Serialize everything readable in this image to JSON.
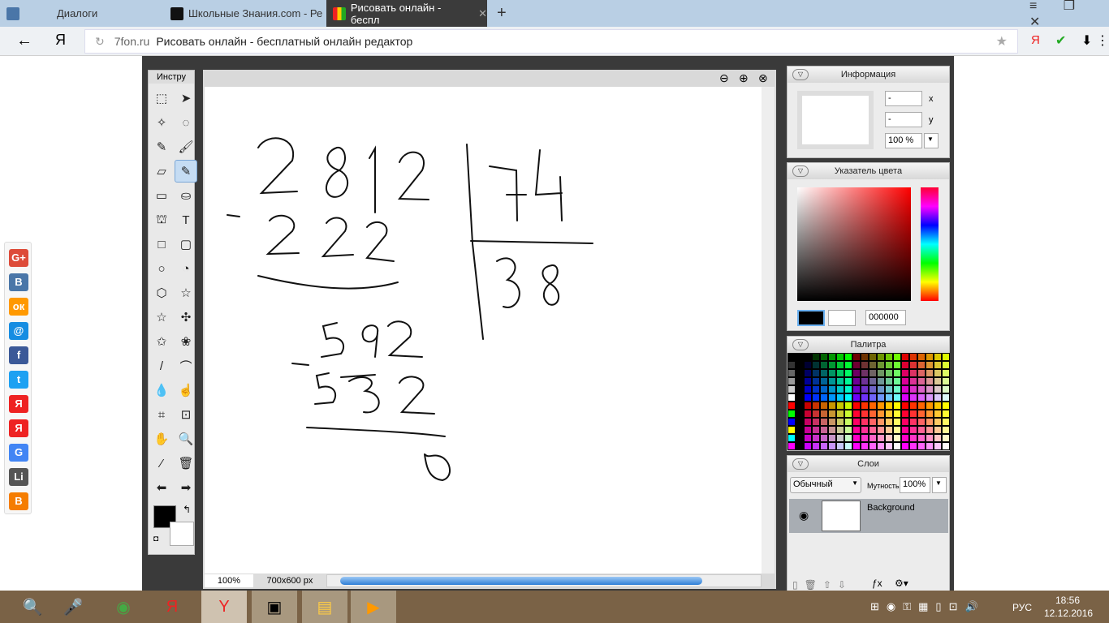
{
  "browser": {
    "tabs": [
      {
        "label": "Диалоги",
        "icon": "vk-dialogs-icon"
      },
      {
        "label": "Школьные Знания.com - Ре",
        "icon": "znanija-icon"
      },
      {
        "label": "Рисовать онлайн - беспл",
        "icon": "7fon-icon",
        "active": true
      }
    ],
    "domain": "7fon.ru",
    "page_title": "Рисовать онлайн - бесплатный онлайн редактор",
    "back": "←",
    "yandex": "Я"
  },
  "tools": {
    "title": "Инстру",
    "items": [
      "rect-select",
      "move",
      "magic-wand",
      "lasso",
      "pencil",
      "brush",
      "eraser",
      "paintbrush-selected",
      "gradient",
      "paint-bucket",
      "stamp",
      "text",
      "rectangle",
      "rounded-rect",
      "ellipse",
      "pie",
      "hexagon",
      "star",
      "star5",
      "puzzle",
      "custom-shape",
      "flower",
      "line",
      "curve",
      "blur",
      "smudge",
      "crop",
      "transform",
      "hand",
      "zoom",
      "eyedropper",
      "trash",
      "undo",
      "redo"
    ],
    "foreground": "#000000",
    "background": "#ffffff"
  },
  "document": {
    "zoom": "100%",
    "size": "700x600 px"
  },
  "info": {
    "title": "Информация",
    "x_label": "x",
    "y_label": "y",
    "x": "-",
    "y": "-",
    "zoom": "100 %"
  },
  "color": {
    "title": "Указатель цвета",
    "hex": "000000"
  },
  "palette": {
    "title": "Палитра"
  },
  "layers": {
    "title": "Слои",
    "blend": "Обычный",
    "opacity_label": "Мутность:",
    "opacity": "100%",
    "layer_name": "Background"
  },
  "social": [
    "G+",
    "B",
    "ок",
    "@",
    "f",
    "t",
    "Я",
    "Я",
    "G",
    "Li",
    "B"
  ],
  "taskbar": {
    "lang": "РУС",
    "time": "18:56",
    "date": "12.12.2016"
  }
}
